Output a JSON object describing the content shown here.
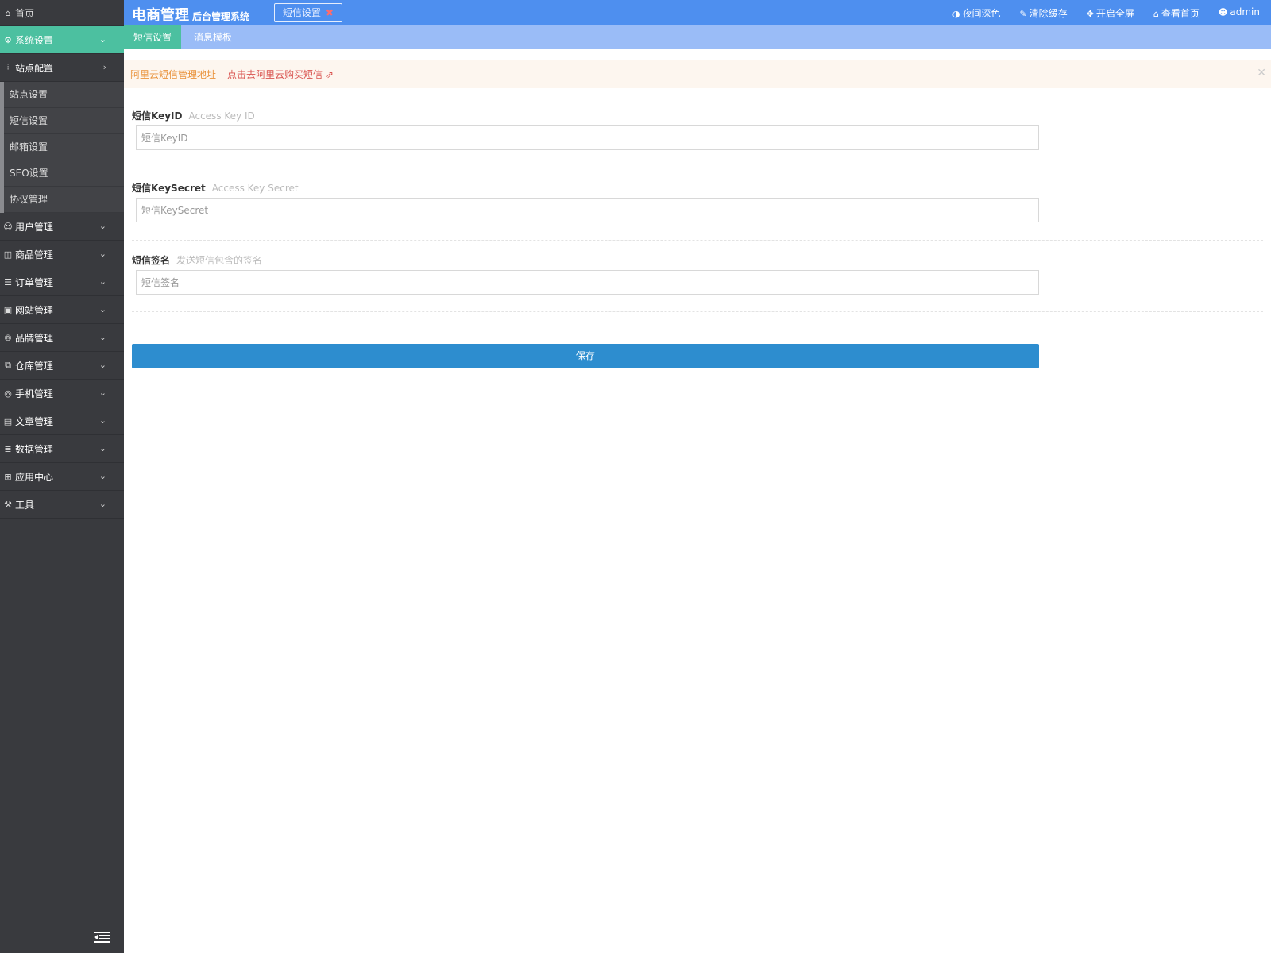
{
  "sidebar": {
    "home_label": "首页",
    "active_label": "系统设置",
    "site_config_label": "站点配置",
    "sub_items": [
      "站点设置",
      "短信设置",
      "邮箱设置",
      "SEO设置",
      "协议管理"
    ],
    "menu": [
      "用户管理",
      "商品管理",
      "订单管理",
      "网站管理",
      "品牌管理",
      "仓库管理",
      "手机管理",
      "文章管理",
      "数据管理",
      "应用中心",
      "工具"
    ]
  },
  "header": {
    "brand": "电商管理",
    "brand_sub": "后台管理系统",
    "open_tab": "短信设置",
    "nav": {
      "dark_mode": "夜间深色",
      "clear_cache": "清除缓存",
      "fullscreen": "开启全屏",
      "view_home": "查看首页",
      "user": "admin"
    }
  },
  "subtabs": [
    "短信设置",
    "消息模板"
  ],
  "alert": {
    "text": "阿里云短信管理地址",
    "link": "点击去阿里云购买短信"
  },
  "form": {
    "key_id": {
      "label": "短信KeyID",
      "hint": "Access Key ID",
      "placeholder": "短信KeyID"
    },
    "key_secret": {
      "label": "短信KeySecret",
      "hint": "Access Key Secret",
      "placeholder": "短信KeySecret"
    },
    "signature": {
      "label": "短信签名",
      "hint": "发送短信包含的签名",
      "placeholder": "短信签名"
    },
    "save_label": "保存"
  },
  "colors": {
    "header": "#4e8fef",
    "subtabs": "#9abcf7",
    "active": "#4cc0a0",
    "sidebar": "#393a3e",
    "save_button": "#2d8dcf"
  }
}
